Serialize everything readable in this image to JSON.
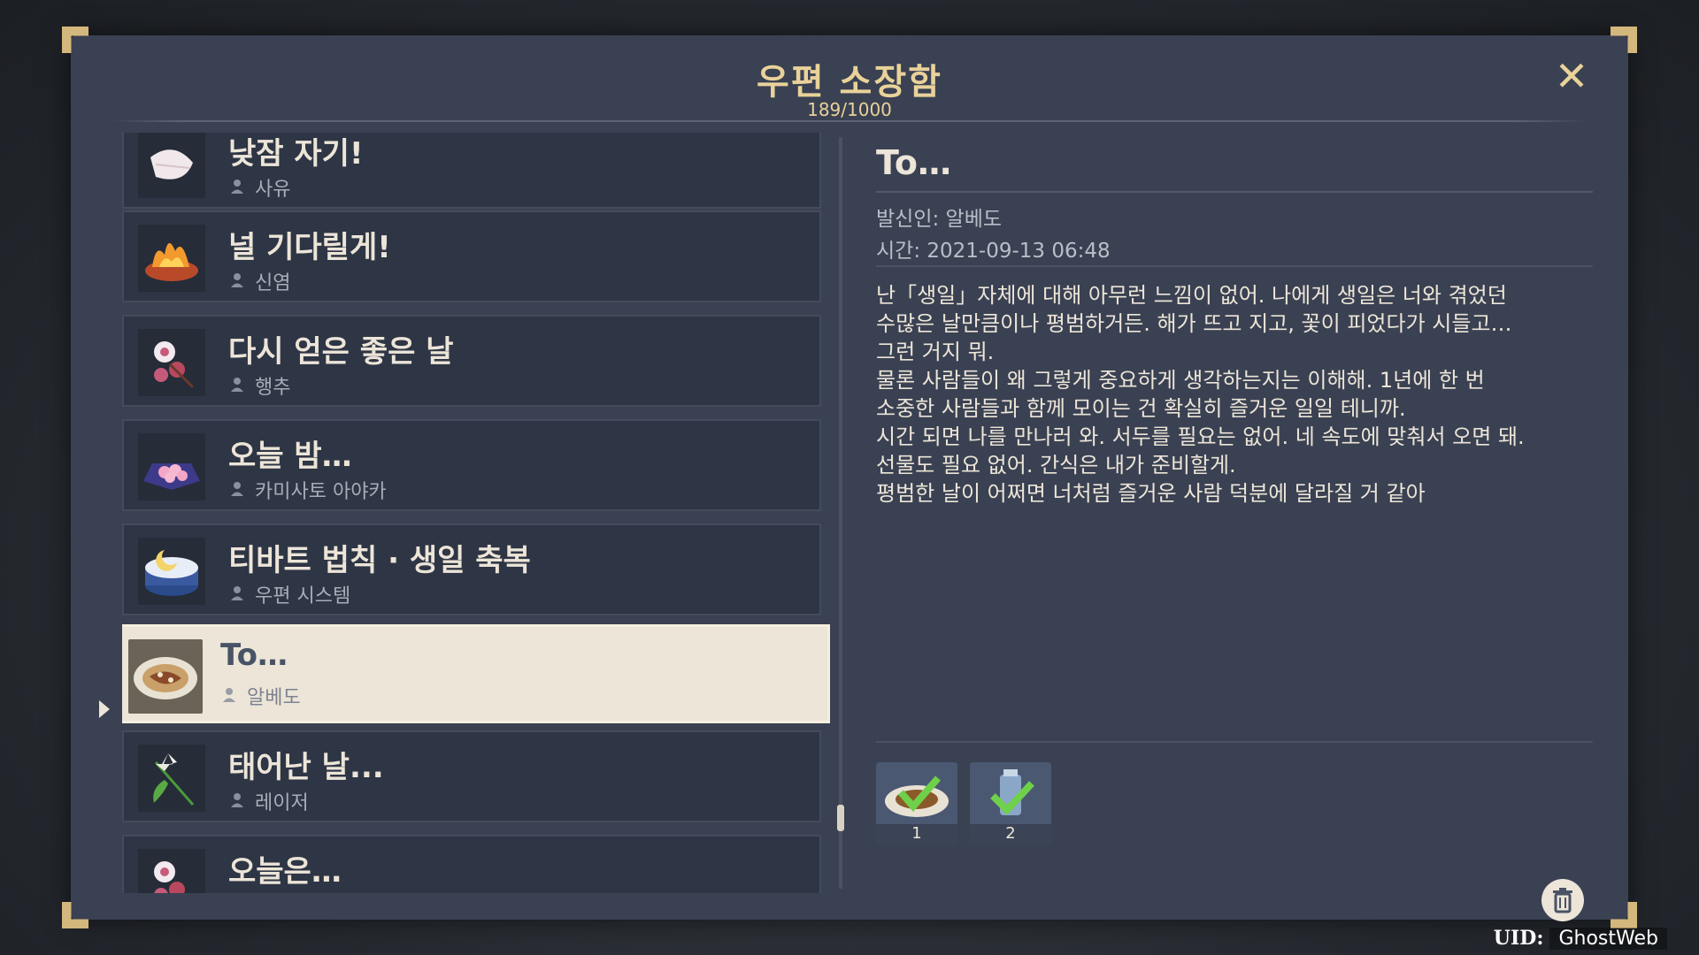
{
  "header": {
    "title": "우편 소장함",
    "count": "189/1000",
    "close_label": "✕"
  },
  "mails": [
    {
      "title": "낮잠 자기!",
      "sender": "사유",
      "icon": "mail-thumb-fish"
    },
    {
      "title": "널 기다릴게!",
      "sender": "신염",
      "icon": "mail-thumb-fire-dish"
    },
    {
      "title": "다시 얻은 좋은 날",
      "sender": "행추",
      "icon": "mail-thumb-flower"
    },
    {
      "title": "오늘 밤…",
      "sender": "카미사토 아야카",
      "icon": "mail-thumb-sweets"
    },
    {
      "title": "티바트 법칙 · 생일 축복",
      "sender": "우편 시스템",
      "icon": "mail-thumb-cake"
    },
    {
      "title": "To…",
      "sender": "알베도",
      "icon": "mail-thumb-dish",
      "selected": true
    },
    {
      "title": "태어난 날...",
      "sender": "레이저",
      "icon": "mail-thumb-lily"
    },
    {
      "title": "오늘은…",
      "sender": "",
      "icon": "mail-thumb-flower"
    }
  ],
  "detail": {
    "title": "To…",
    "sender": "발신인: 알베도",
    "time": "시간: 2021-09-13 06:48",
    "body": "난「생일」자체에 대해 아무런 느낌이 없어. 나에게 생일은 너와 겪었던\n수많은 날만큼이나 평범하거든. 해가 뜨고 지고, 꽃이 피었다가 시들고…\n그런 거지 뭐.\n물론 사람들이 왜 그렇게 중요하게 생각하는지는 이해해. 1년에 한 번\n소중한 사람들과 함께 모이는 건 확실히 즐거운 일일 테니까.\n시간 되면 나를 만나러 와. 서두를 필요는 없어. 네 속도에 맞춰서 오면 돼.\n선물도 필요 없어. 간식은 내가 준비할게.\n평범한 날이 어쩌면 너처럼 즐거운 사람 덕분에 달라질 거 같아",
    "attachments": [
      {
        "count": "1",
        "icon": "dish-item-icon",
        "claimed": true
      },
      {
        "count": "2",
        "icon": "potion-item-icon",
        "claimed": true
      }
    ]
  },
  "footer": {
    "uid_label": "UID:",
    "uid_value": "GhostWeb"
  },
  "colors": {
    "panel": "#3a4152",
    "accent_gold": "#e9d29a",
    "selected_bg": "#ece5d8"
  }
}
